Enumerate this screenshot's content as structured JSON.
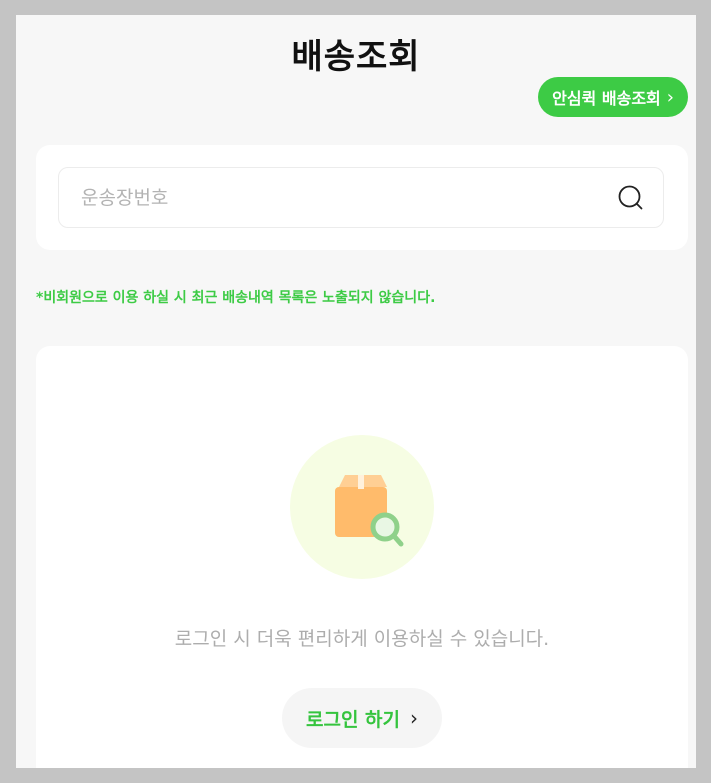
{
  "header": {
    "title": "배송조회"
  },
  "safe_quick": {
    "label": "안심퀵 배송조회",
    "chevron": "›"
  },
  "search": {
    "placeholder": "운송장번호",
    "value": "",
    "icon": "search-icon"
  },
  "notice": {
    "text": "*비회원으로 이용 하실 시 최근 배송내역 목록은 노출되지 않습니다."
  },
  "empty_state": {
    "illustration": "package-search-icon",
    "message": "로그인 시 더욱 편리하게 이용하실 수 있습니다.",
    "login_label": "로그인 하기",
    "login_chevron": "›"
  },
  "colors": {
    "accent": "#3dcb45",
    "background": "#f7f7f7",
    "card": "#ffffff",
    "illustration_bg": "#f6fde3",
    "box": "#ffb866",
    "magnifier": "#8fd18a"
  }
}
